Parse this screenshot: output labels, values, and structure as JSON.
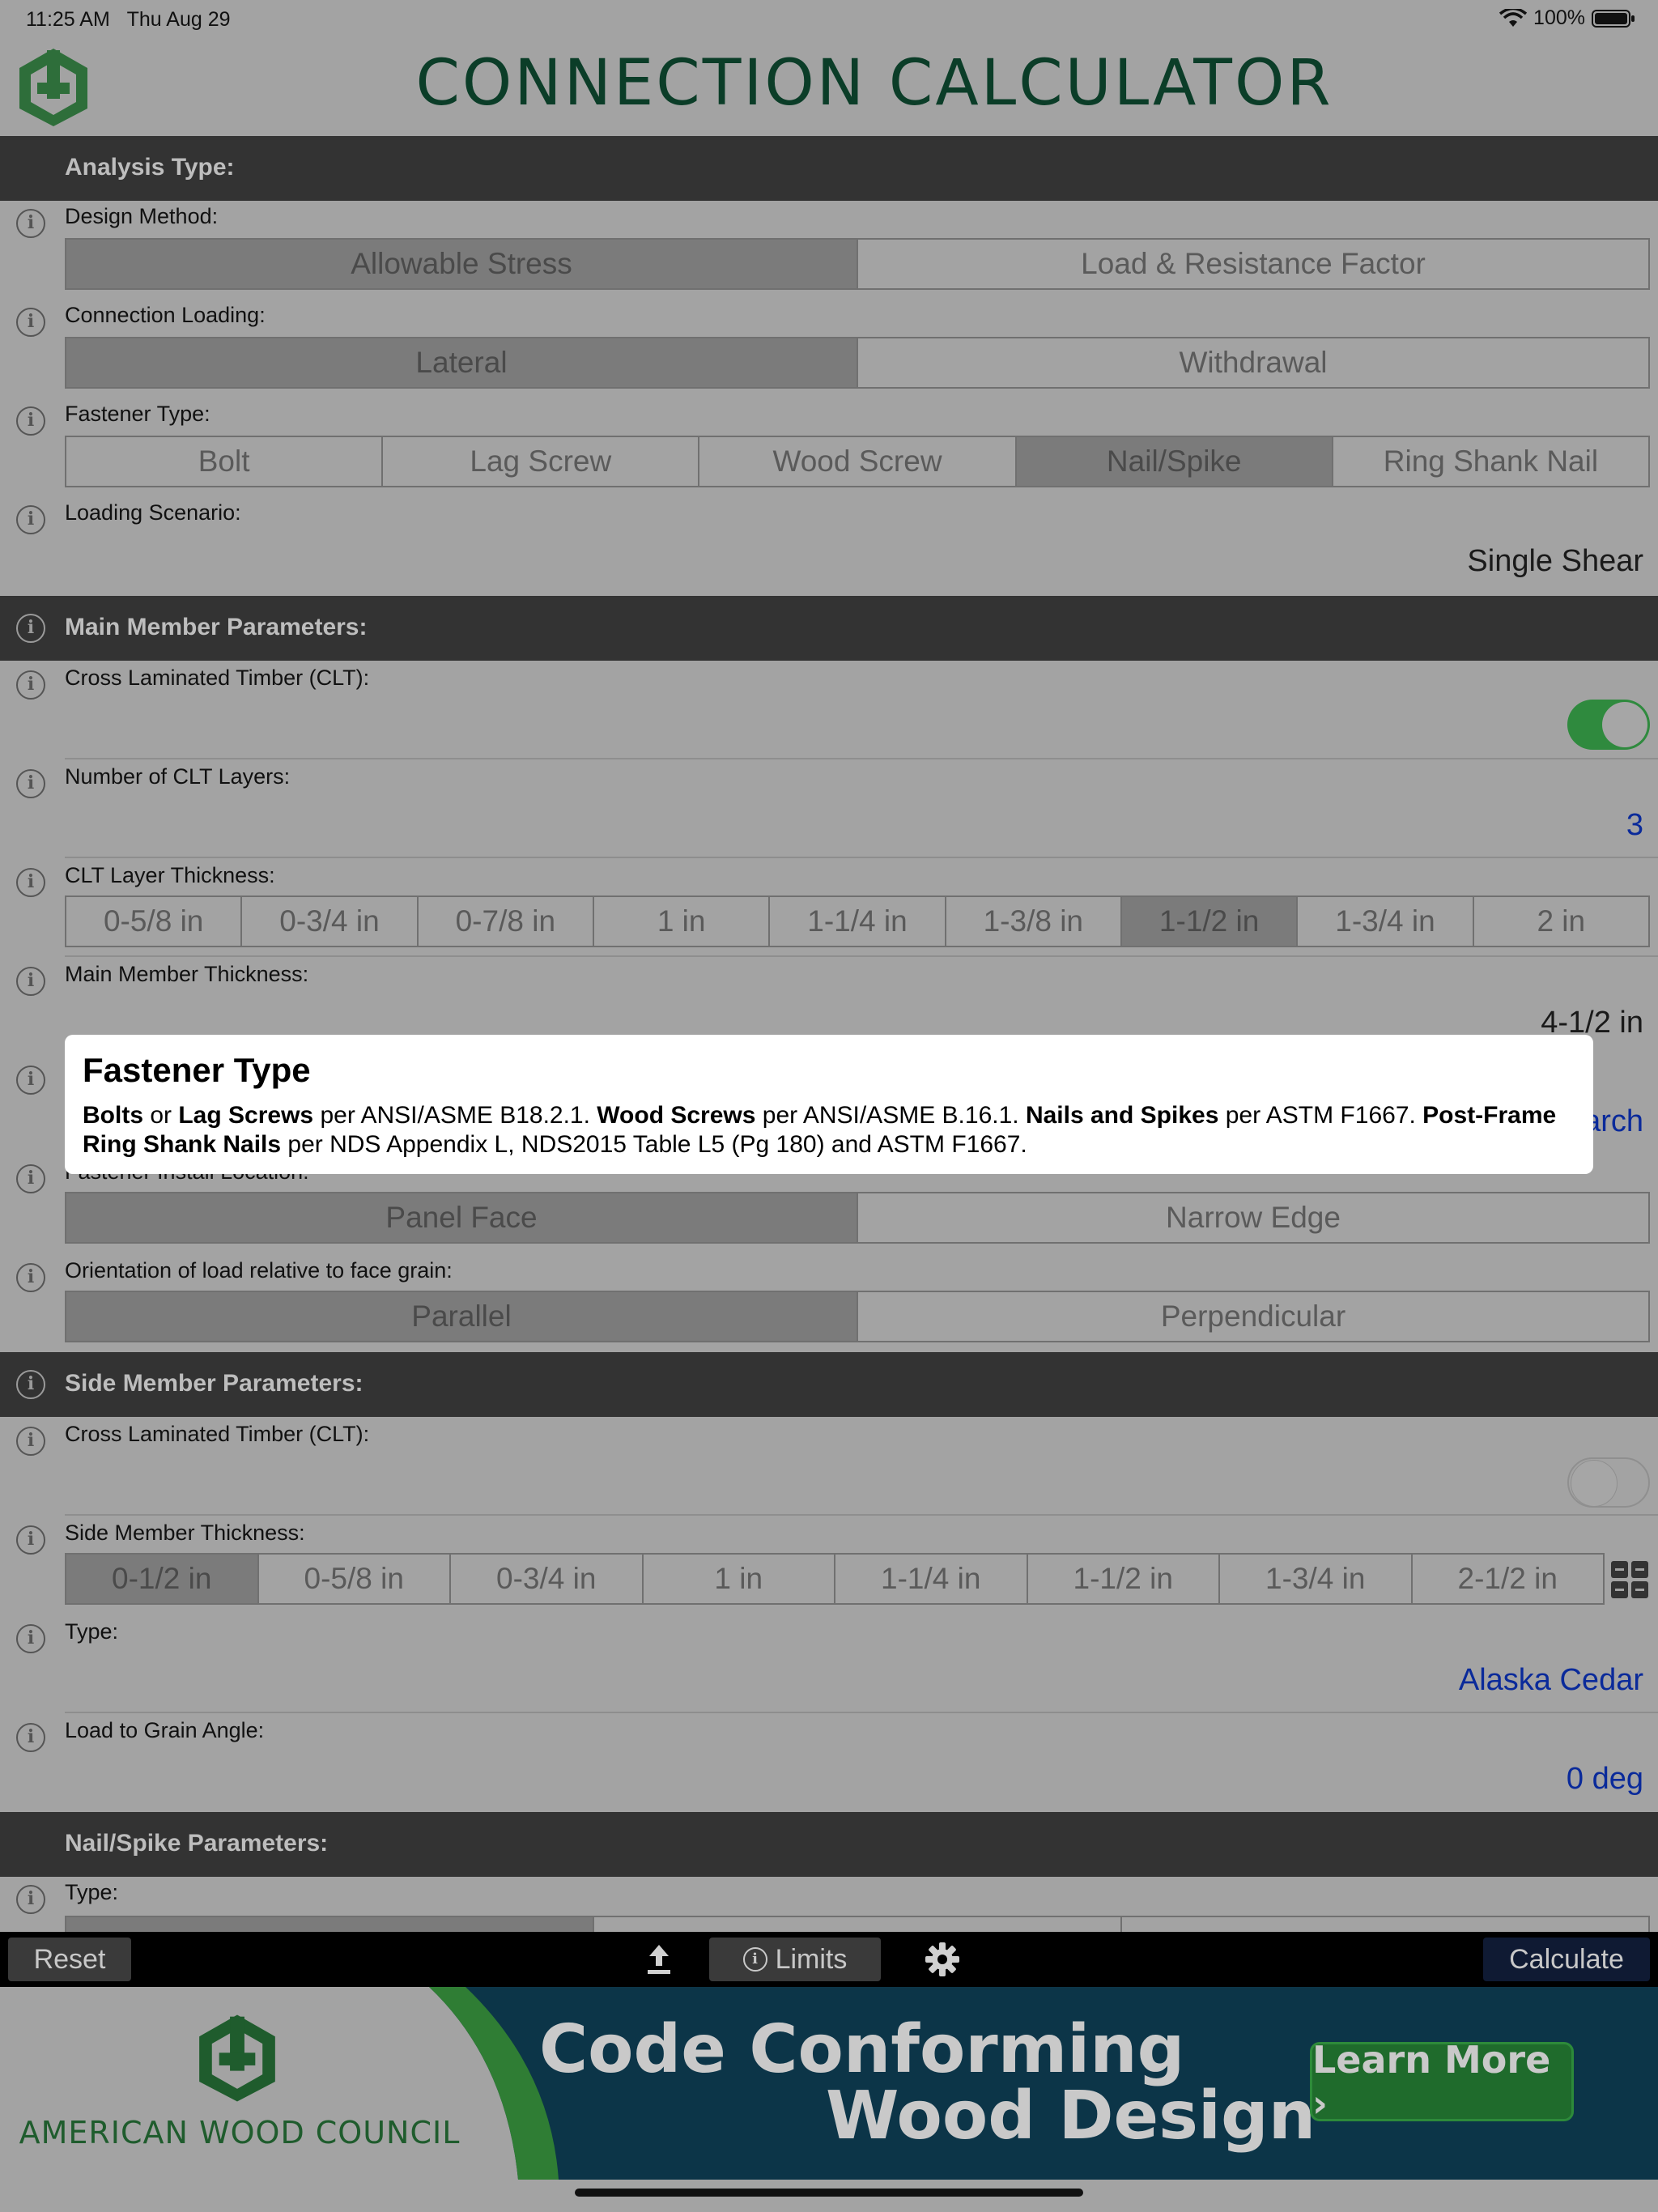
{
  "status_bar": {
    "time": "11:25 AM",
    "date": "Thu Aug 29",
    "battery": "100%"
  },
  "header": {
    "title": "CONNECTION CALCULATOR"
  },
  "analysis": {
    "section_label": "Analysis Type:",
    "design_method": {
      "label": "Design Method:",
      "options": [
        "Allowable Stress",
        "Load & Resistance Factor"
      ],
      "selected": "Allowable Stress"
    },
    "connection_loading": {
      "label": "Connection Loading:",
      "options": [
        "Lateral",
        "Withdrawal"
      ],
      "selected": "Lateral"
    },
    "fastener_type": {
      "label": "Fastener Type:",
      "options": [
        "Bolt",
        "Lag Screw",
        "Wood Screw",
        "Nail/Spike",
        "Ring Shank Nail"
      ],
      "selected": "Nail/Spike"
    },
    "loading_scenario": {
      "label": "Loading Scenario:",
      "value": "Single Shear"
    }
  },
  "main_member": {
    "section_label": "Main Member Parameters:",
    "clt": {
      "label": "Cross Laminated Timber (CLT):",
      "on": true
    },
    "clt_layers": {
      "label": "Number of CLT Layers:",
      "value": "3"
    },
    "layer_thickness": {
      "label": "CLT Layer Thickness:",
      "options": [
        "0-5/8 in",
        "0-3/4 in",
        "0-7/8 in",
        "1 in",
        "1-1/4 in",
        "1-3/8 in",
        "1-1/2 in",
        "1-3/4 in",
        "2 in"
      ],
      "selected": "1-1/2 in"
    },
    "thickness": {
      "label": "Main Member Thickness:",
      "value": "4-1/2 in"
    },
    "partial_value": "arch",
    "install_location": {
      "label": "Fastener Install Location:",
      "options": [
        "Panel Face",
        "Narrow Edge"
      ],
      "selected": "Panel Face"
    },
    "orientation": {
      "label": "Orientation of load relative to face grain:",
      "options": [
        "Parallel",
        "Perpendicular"
      ],
      "selected": "Parallel"
    }
  },
  "side_member": {
    "section_label": "Side Member Parameters:",
    "clt": {
      "label": "Cross Laminated Timber (CLT):",
      "on": false
    },
    "thickness": {
      "label": "Side Member Thickness:",
      "options": [
        "0-1/2 in",
        "0-5/8 in",
        "0-3/4 in",
        "1 in",
        "1-1/4 in",
        "1-1/2 in",
        "1-3/4 in",
        "2-1/2 in"
      ],
      "selected": "0-1/2 in"
    },
    "type": {
      "label": "Type:",
      "value": "Alaska Cedar"
    },
    "load_angle": {
      "label": "Load to Grain Angle:",
      "value": "0 deg"
    }
  },
  "nail_params": {
    "section_label": "Nail/Spike Parameters:",
    "type_label": "Type:"
  },
  "popup": {
    "title": "Fastener Type",
    "bolts": "Bolts",
    "or": " or ",
    "lag": "Lag Screws",
    "t1": " per ANSI/ASME B18.2.1. ",
    "wood": "Wood Screws",
    "t2": " per ANSI/ASME B.16.1. ",
    "nails": "Nails and Spikes",
    "t3": " per ASTM F1667. ",
    "ring": "Post-Frame Ring Shank Nails",
    "t4": " per NDS Appendix L, NDS2015 Table L5 (Pg 180) and ASTM F1667."
  },
  "toolbar": {
    "reset": "Reset",
    "limits": "Limits",
    "calculate": "Calculate"
  },
  "banner": {
    "org": "AMERICAN WOOD COUNCIL",
    "headline1": "Code Conforming",
    "headline2": "Wood Design",
    "cta": "Learn More ›"
  },
  "colors": {
    "brand_green": "#0b3d28",
    "toggle_on": "#2f8a3e",
    "link_blue": "#0a2a9a",
    "banner_navy": "#0c3548"
  }
}
